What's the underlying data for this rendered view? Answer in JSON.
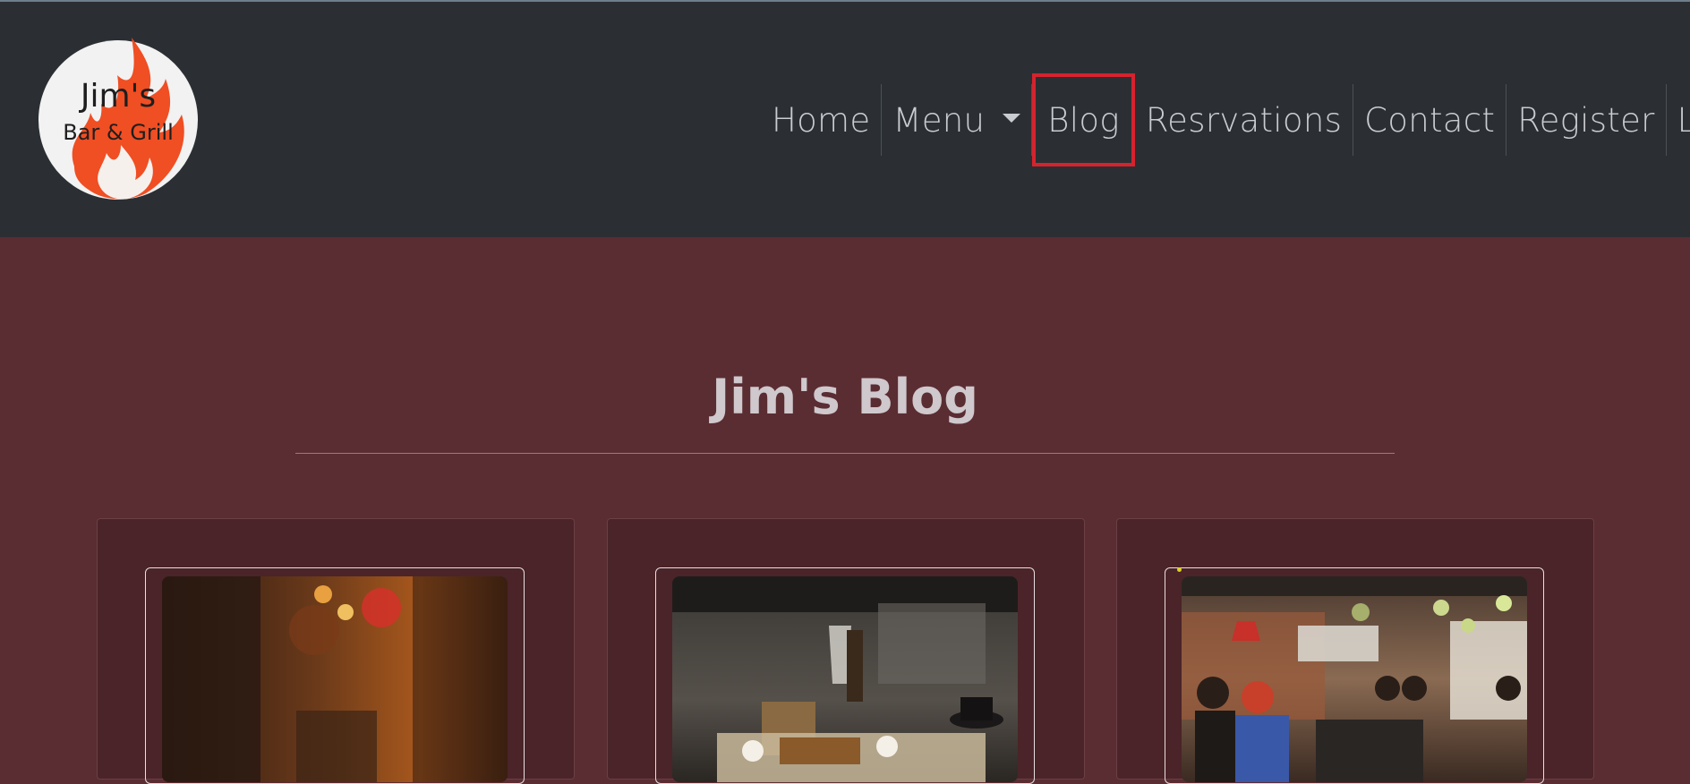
{
  "brand": {
    "logo_line1": "Jim's",
    "logo_line2": "Bar & Grill"
  },
  "nav": {
    "items": [
      {
        "label": "Home"
      },
      {
        "label": "Menu"
      },
      {
        "label": "Blog"
      },
      {
        "label": "Resrvations"
      },
      {
        "label": "Contact"
      },
      {
        "label": "Register"
      },
      {
        "label": "Login"
      }
    ],
    "active": "Blog"
  },
  "page": {
    "title": "Jim's Blog"
  },
  "cards": [
    {
      "image_icon": "alley-night-photo"
    },
    {
      "image_icon": "cafe-table-photo"
    },
    {
      "image_icon": "bar-interior-photo"
    }
  ],
  "colors": {
    "header_bg": "#2b2f33",
    "page_bg": "#5a2d32",
    "card_bg": "#4a2428",
    "highlight": "#d6232d",
    "flame": "#f04e23"
  }
}
